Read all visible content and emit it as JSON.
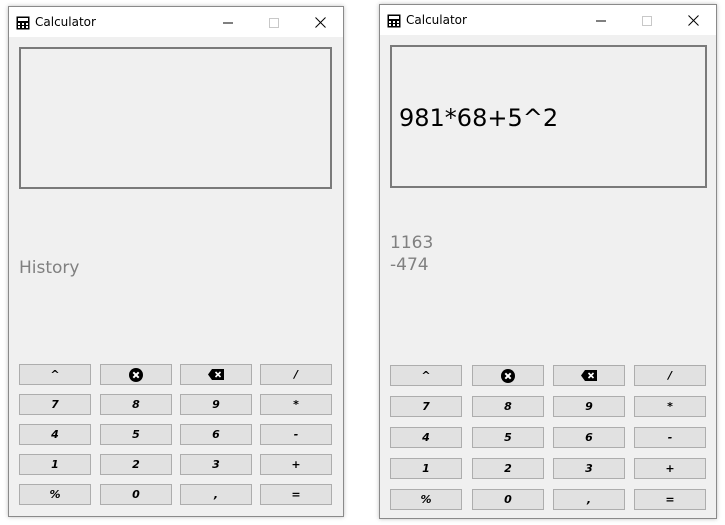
{
  "windows": [
    {
      "title": "Calculator",
      "expression": "",
      "history_title": "History",
      "history": []
    },
    {
      "title": "Calculator",
      "expression": "981*68+5^2",
      "history_title": "",
      "history": [
        "1163",
        "-474"
      ]
    }
  ],
  "icons": {
    "app": "calculator-icon",
    "minimize": "minimize-icon",
    "maximize": "maximize-icon",
    "close": "close-icon",
    "clear": "clear-circle-x-icon",
    "backspace": "backspace-icon"
  },
  "keypad": [
    [
      {
        "label": "^"
      },
      {
        "icon": "clear"
      },
      {
        "icon": "backspace"
      },
      {
        "label": "/"
      }
    ],
    [
      {
        "label": "7"
      },
      {
        "label": "8"
      },
      {
        "label": "9"
      },
      {
        "label": "*"
      }
    ],
    [
      {
        "label": "4"
      },
      {
        "label": "5"
      },
      {
        "label": "6"
      },
      {
        "label": "-"
      }
    ],
    [
      {
        "label": "1"
      },
      {
        "label": "2"
      },
      {
        "label": "3"
      },
      {
        "label": "+"
      }
    ],
    [
      {
        "label": "%"
      },
      {
        "label": "0"
      },
      {
        "label": ","
      },
      {
        "label": "="
      }
    ]
  ],
  "colors": {
    "window_bg": "#f0f0f0",
    "titlebar_bg": "#ffffff",
    "history_text": "#808080",
    "key_bg": "#e1e1e1",
    "key_border": "#adadad"
  }
}
